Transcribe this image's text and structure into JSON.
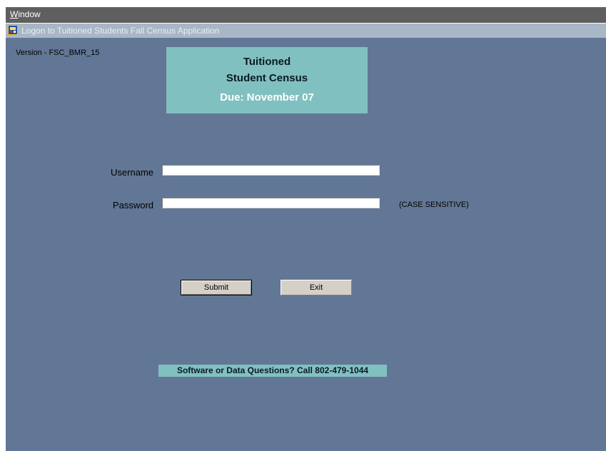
{
  "menubar": {
    "window_mnemonic": "W",
    "window_rest": "indow"
  },
  "titlebar": {
    "title": "Logon to Tuitioned Students Fall Census Application",
    "icon": "app-icon"
  },
  "version": "Version - FSC_BMR_15",
  "banner": {
    "line1": "Tuitioned",
    "line2": "Student Census",
    "due": "Due:  November 07"
  },
  "form": {
    "username_label": "Username",
    "username_value": "",
    "password_label": "Password",
    "password_value": "",
    "password_hint": "(CASE SENSITIVE)"
  },
  "buttons": {
    "submit": "Submit",
    "exit": "Exit"
  },
  "support": "Software or Data Questions?  Call 802-479-1044",
  "colors": {
    "background": "#627795",
    "banner": "#81c0c0",
    "titlebar": "#a9b6c6",
    "menubar": "#5f5f5f"
  }
}
